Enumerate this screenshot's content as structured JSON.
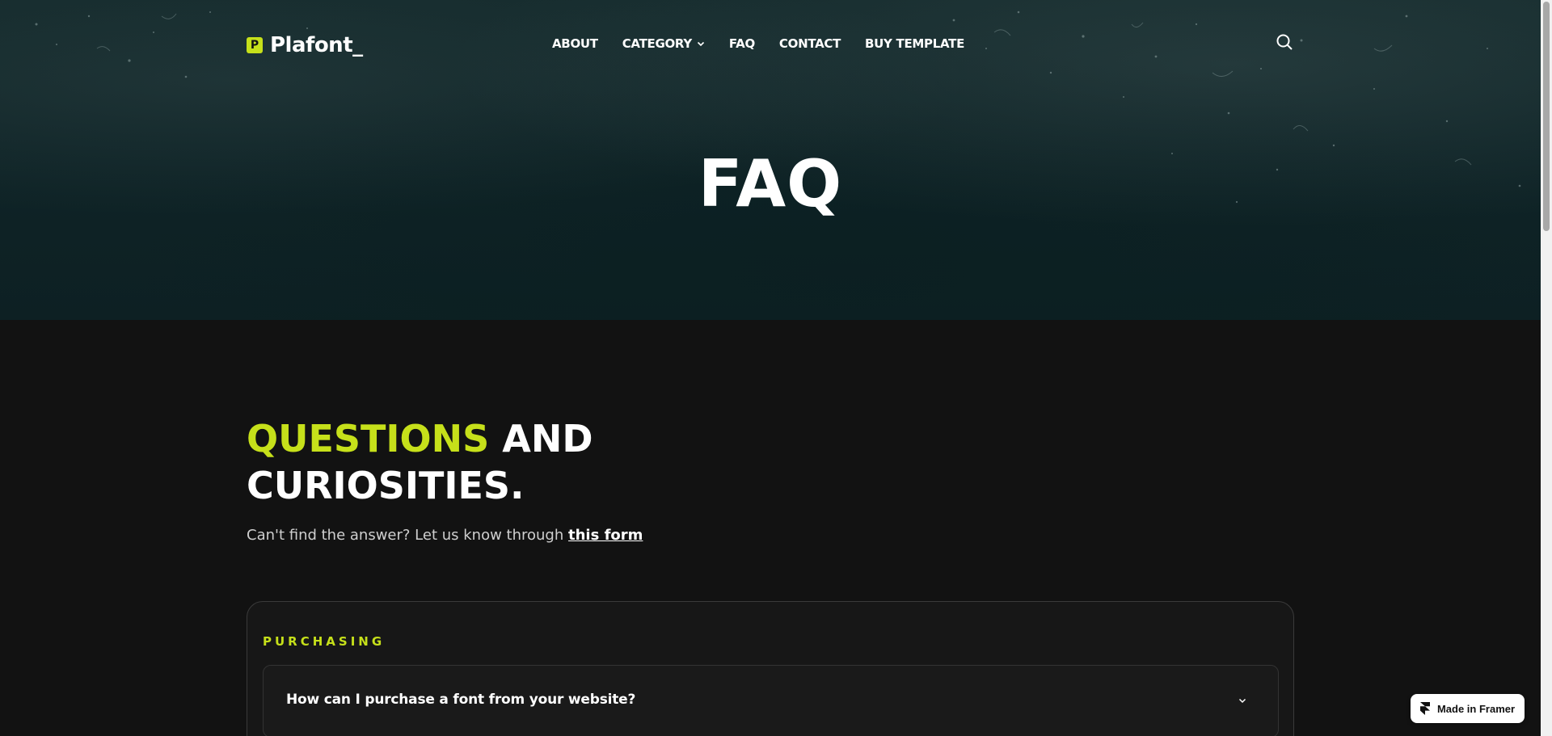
{
  "brand": {
    "logo_letter": "P",
    "name": "Plafont_"
  },
  "nav": {
    "items": [
      {
        "label": "ABOUT"
      },
      {
        "label": "CATEGORY"
      },
      {
        "label": "FAQ"
      },
      {
        "label": "CONTACT"
      },
      {
        "label": "BUY TEMPLATE"
      }
    ],
    "search_icon": "search-icon"
  },
  "hero": {
    "title": "FAQ"
  },
  "section": {
    "headline_accent": "QUESTIONS",
    "headline_rest_1": " AND",
    "headline_rest_2": "CURIOSITIES.",
    "subtext": "Can't find the answer? Let us know through ",
    "subtext_link": "this form"
  },
  "faq": {
    "category": "PURCHASING",
    "items": [
      {
        "question": "How can I purchase a font from your website?"
      }
    ]
  },
  "badge": {
    "label": "Made in Framer"
  },
  "colors": {
    "accent": "#c6e01a",
    "background": "#121212",
    "hero": "#0f2427"
  }
}
